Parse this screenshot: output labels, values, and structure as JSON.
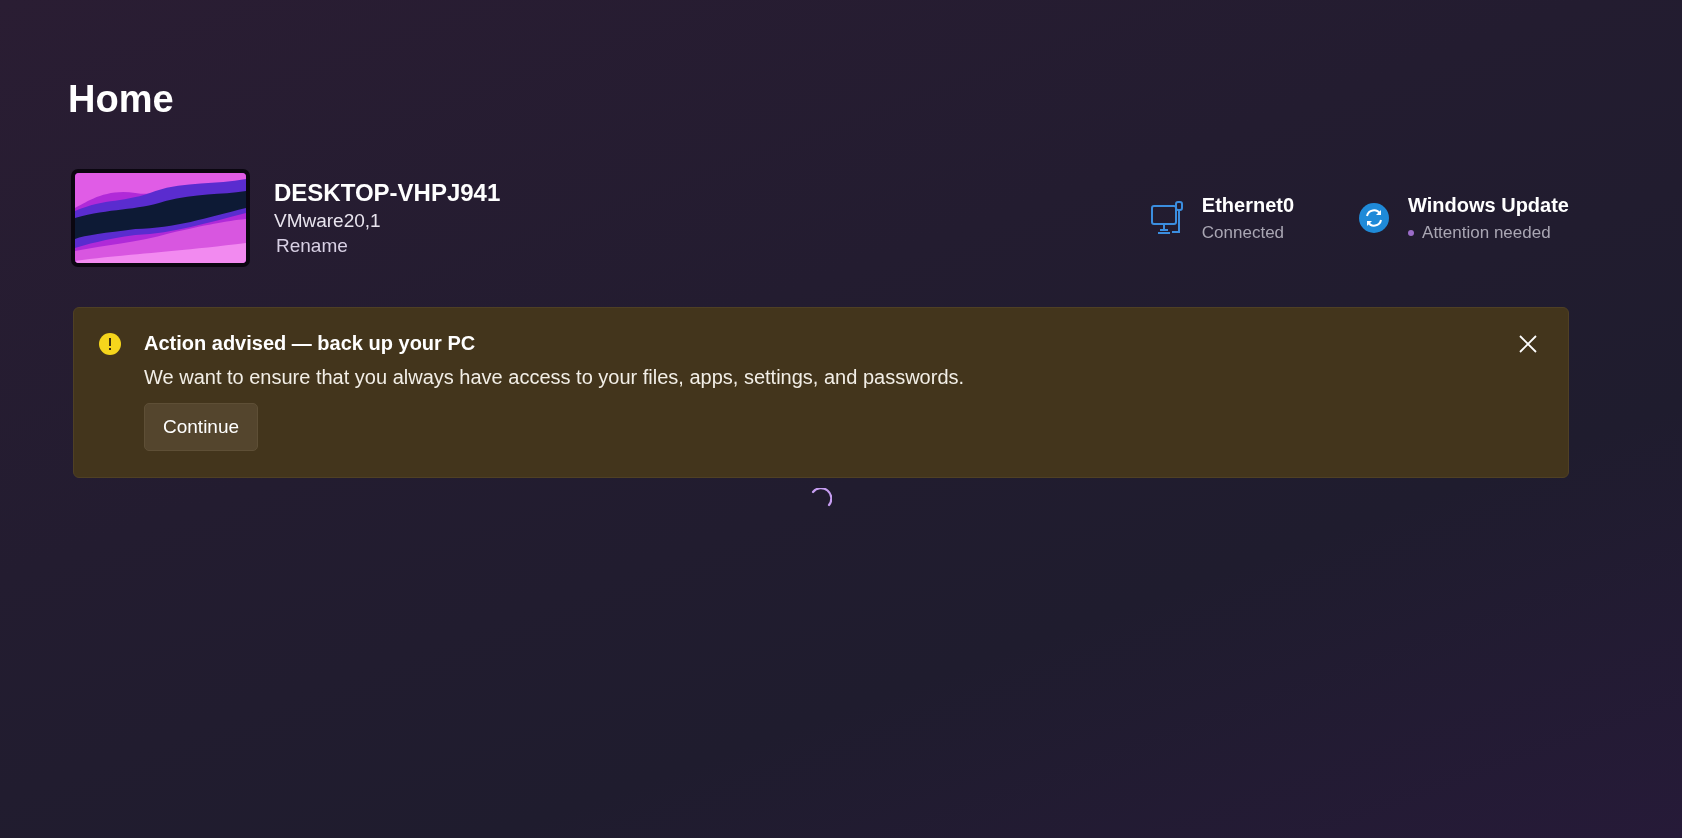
{
  "page_title": "Home",
  "device": {
    "name": "DESKTOP-VHPJ941",
    "model": "VMware20,1",
    "rename_link": "Rename"
  },
  "status_items": [
    {
      "kind": "network",
      "title": "Ethernet0",
      "subtitle": "Connected",
      "attention": false
    },
    {
      "kind": "update",
      "title": "Windows Update",
      "subtitle": "Attention needed",
      "attention": true
    }
  ],
  "banner": {
    "kind": "warning",
    "title": "Action advised — back up your PC",
    "message": "We want to ensure that you always have access to your files, apps, settings, and passwords.",
    "button": "Continue",
    "dismissible": true
  },
  "loading": true
}
